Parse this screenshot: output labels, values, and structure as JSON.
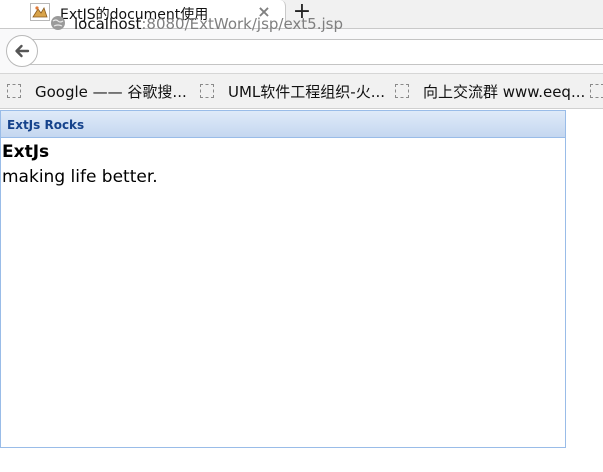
{
  "browser": {
    "tab": {
      "title": "ExtJS的document使用",
      "close_glyph": "×"
    },
    "new_tab_glyph": "+",
    "url": {
      "host": "localhost",
      "rest": ":8080/ExtWork/jsp/ext5.jsp"
    },
    "bookmarks": [
      {
        "label": "Google —— 谷歌搜..."
      },
      {
        "label": "UML软件工程组织-火..."
      },
      {
        "label": "向上交流群 www.eeq..."
      }
    ]
  },
  "page": {
    "panel_title": "ExtJs Rocks",
    "heading": "ExtJs",
    "body_text": "making life better."
  }
}
